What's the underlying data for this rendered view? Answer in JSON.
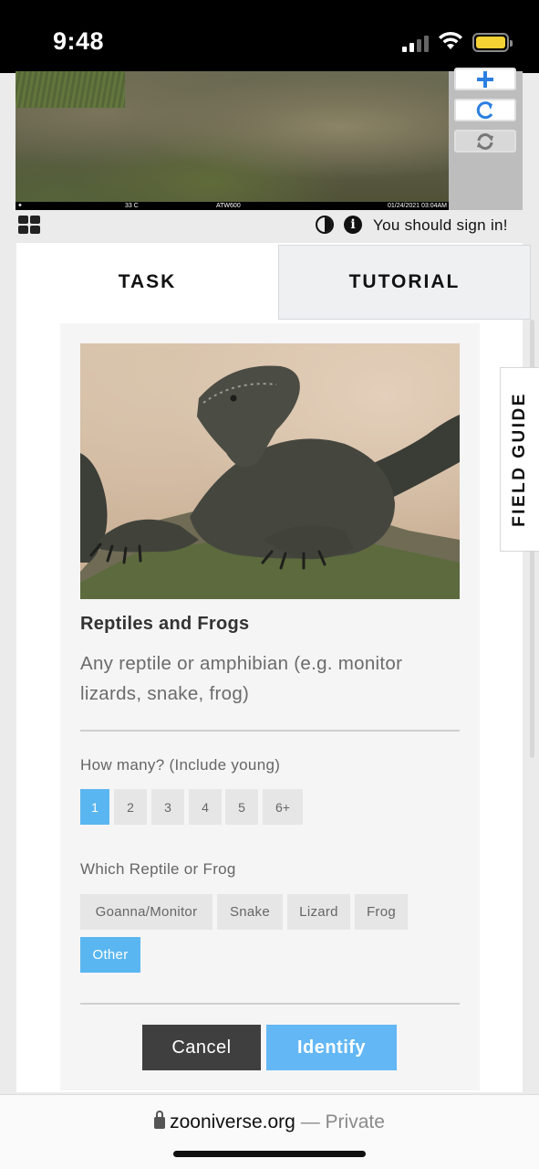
{
  "status_bar": {
    "time": "9:48"
  },
  "viewer": {
    "camera_strip": {
      "temp": "33 C",
      "model": "ATW600",
      "datetime": "01/24/2021 03:04AM"
    },
    "controls": [
      "zoom-in",
      "reset-rotation",
      "refresh"
    ]
  },
  "toolbar": {
    "sign_in_text": "You should sign in!"
  },
  "tabs": {
    "task": "TASK",
    "tutorial": "TUTORIAL"
  },
  "field_guide": {
    "label": "FIELD GUIDE"
  },
  "choice": {
    "title": "Reptiles and Frogs",
    "description": "Any reptile or amphibian (e.g. monitor lizards, snake, frog)"
  },
  "questions": {
    "how_many": {
      "label": "How many? (Include young)",
      "options": [
        "1",
        "2",
        "3",
        "4",
        "5",
        "6+"
      ],
      "selected": "1"
    },
    "which": {
      "label": "Which Reptile or Frog",
      "options": [
        "Goanna/Monitor",
        "Snake",
        "Lizard",
        "Frog",
        "Other"
      ],
      "selected": "Other"
    }
  },
  "actions": {
    "cancel": "Cancel",
    "identify": "Identify"
  },
  "browser": {
    "domain": "zooniverse.org",
    "separator": "—",
    "mode": "Private"
  },
  "colors": {
    "accent": "#5ab6f0",
    "cancel": "#3f3f3f"
  }
}
